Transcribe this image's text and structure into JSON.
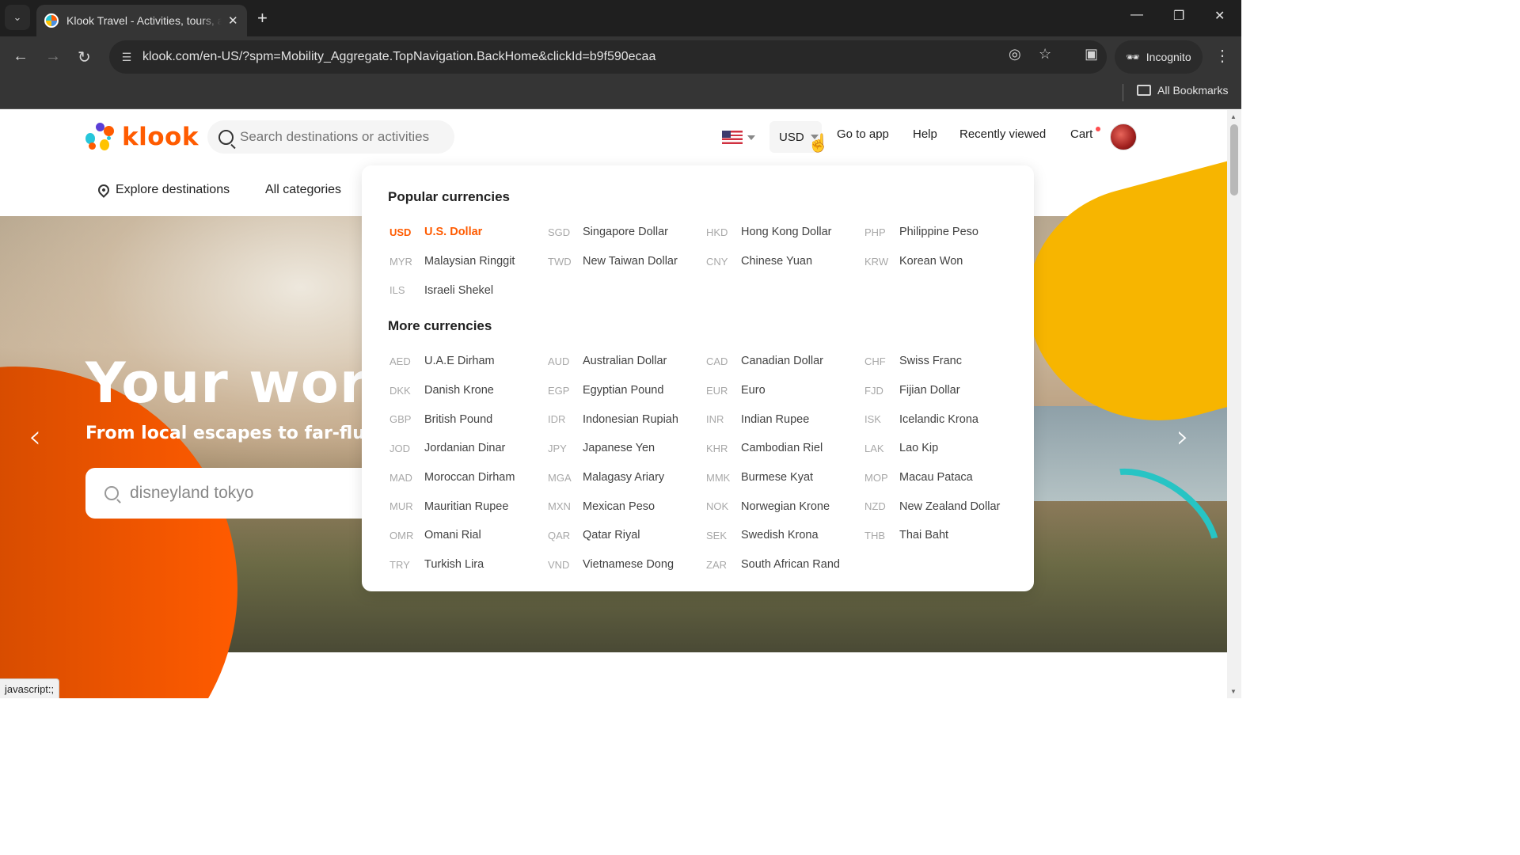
{
  "browser": {
    "tab_title": "Klook Travel - Activities, tours, attractions",
    "url": "klook.com/en-US/?spm=Mobility_Aggregate.TopNavigation.BackHome&clickId=b9f590ecaa",
    "incognito_label": "Incognito",
    "all_bookmarks_label": "All Bookmarks",
    "status_text": "javascript:;"
  },
  "header": {
    "logo_text": "klook",
    "search_placeholder": "Search destinations or activities",
    "currency": "USD",
    "links": {
      "go_to_app": "Go to app",
      "help": "Help",
      "recently_viewed": "Recently viewed",
      "cart": "Cart"
    }
  },
  "subnav": {
    "explore": "Explore destinations",
    "categories": "All categories"
  },
  "hero": {
    "title": "Your world of joy",
    "subtitle": "From local escapes to far-flung adventures",
    "search_value": "disneyland tokyo"
  },
  "currency_dropdown": {
    "popular_heading": "Popular currencies",
    "more_heading": "More currencies",
    "selected": "USD",
    "accent_color": "#ff5b00",
    "popular": [
      {
        "code": "USD",
        "name": "U.S. Dollar"
      },
      {
        "code": "SGD",
        "name": "Singapore Dollar"
      },
      {
        "code": "HKD",
        "name": "Hong Kong Dollar"
      },
      {
        "code": "PHP",
        "name": "Philippine Peso"
      },
      {
        "code": "MYR",
        "name": "Malaysian Ringgit"
      },
      {
        "code": "TWD",
        "name": "New Taiwan Dollar"
      },
      {
        "code": "CNY",
        "name": "Chinese Yuan"
      },
      {
        "code": "KRW",
        "name": "Korean Won"
      },
      {
        "code": "ILS",
        "name": "Israeli Shekel"
      }
    ],
    "more": [
      {
        "code": "AED",
        "name": "U.A.E Dirham"
      },
      {
        "code": "AUD",
        "name": "Australian Dollar"
      },
      {
        "code": "CAD",
        "name": "Canadian Dollar"
      },
      {
        "code": "CHF",
        "name": "Swiss Franc"
      },
      {
        "code": "DKK",
        "name": "Danish Krone"
      },
      {
        "code": "EGP",
        "name": "Egyptian Pound"
      },
      {
        "code": "EUR",
        "name": "Euro"
      },
      {
        "code": "FJD",
        "name": "Fijian Dollar"
      },
      {
        "code": "GBP",
        "name": "British Pound"
      },
      {
        "code": "IDR",
        "name": "Indonesian Rupiah"
      },
      {
        "code": "INR",
        "name": "Indian Rupee"
      },
      {
        "code": "ISK",
        "name": "Icelandic Krona"
      },
      {
        "code": "JOD",
        "name": "Jordanian Dinar"
      },
      {
        "code": "JPY",
        "name": "Japanese Yen"
      },
      {
        "code": "KHR",
        "name": "Cambodian Riel"
      },
      {
        "code": "LAK",
        "name": "Lao Kip"
      },
      {
        "code": "MAD",
        "name": "Moroccan Dirham"
      },
      {
        "code": "MGA",
        "name": "Malagasy Ariary"
      },
      {
        "code": "MMK",
        "name": "Burmese Kyat"
      },
      {
        "code": "MOP",
        "name": "Macau Pataca"
      },
      {
        "code": "MUR",
        "name": "Mauritian Rupee"
      },
      {
        "code": "MXN",
        "name": "Mexican Peso"
      },
      {
        "code": "NOK",
        "name": "Norwegian Krone"
      },
      {
        "code": "NZD",
        "name": "New Zealand Dollar"
      },
      {
        "code": "OMR",
        "name": "Omani Rial"
      },
      {
        "code": "QAR",
        "name": "Qatar Riyal"
      },
      {
        "code": "SEK",
        "name": "Swedish Krona"
      },
      {
        "code": "THB",
        "name": "Thai Baht"
      },
      {
        "code": "TRY",
        "name": "Turkish Lira"
      },
      {
        "code": "VND",
        "name": "Vietnamese Dong"
      },
      {
        "code": "ZAR",
        "name": "South African Rand"
      }
    ]
  }
}
